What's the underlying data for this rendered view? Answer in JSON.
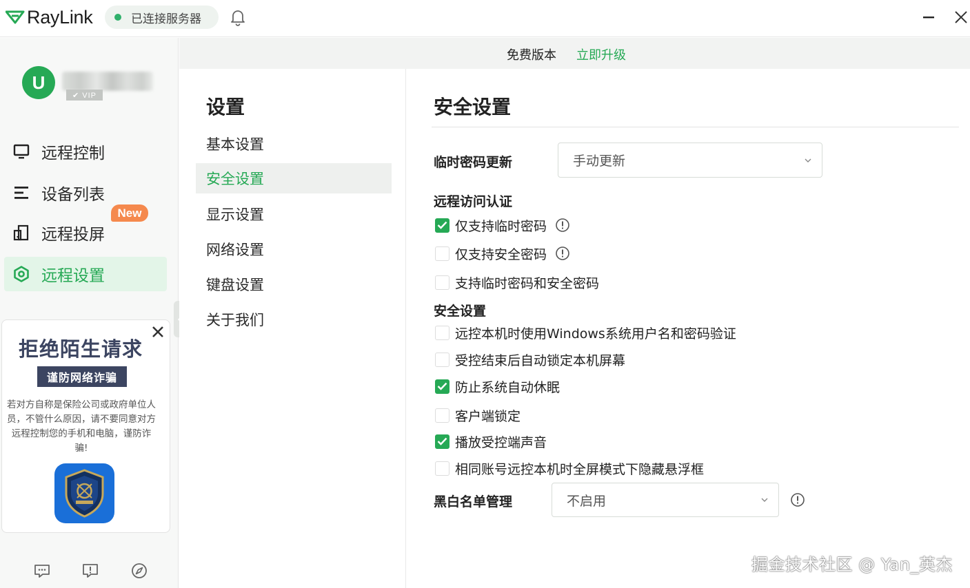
{
  "app": {
    "name": "RayLink",
    "connection_status": "已连接服务器",
    "colors": {
      "accent": "#26a955",
      "badge": "#f5894d",
      "promo_dark": "#3c4561"
    }
  },
  "user": {
    "avatar_letter": "U",
    "vip_label": "✔ VIP"
  },
  "sidebar": {
    "items": [
      {
        "label": "远程控制",
        "icon": "monitor-icon"
      },
      {
        "label": "设备列表",
        "icon": "list-icon"
      },
      {
        "label": "远程投屏",
        "icon": "screen-cast-icon",
        "badge": "New"
      },
      {
        "label": "远程设置",
        "icon": "settings-hex-icon",
        "active": true
      }
    ],
    "footer_icons": [
      "chat-icon",
      "feedback-icon",
      "compass-icon"
    ]
  },
  "promo": {
    "title": "拒绝陌生请求",
    "subtitle": "谨防网络诈骗",
    "body": "若对方自称是保险公司或政府单位人员，不管什么原因，请不要同意对方远程控制您的手机和电脑，谨防诈骗!"
  },
  "banner": {
    "edition": "免费版本",
    "upgrade": "立即升级"
  },
  "settings_menu": {
    "title": "设置",
    "items": [
      {
        "label": "基本设置"
      },
      {
        "label": "安全设置",
        "active": true
      },
      {
        "label": "显示设置"
      },
      {
        "label": "网络设置"
      },
      {
        "label": "键盘设置"
      },
      {
        "label": "关于我们"
      }
    ]
  },
  "content": {
    "title": "安全设置",
    "temp_password": {
      "label": "临时密码更新",
      "value": "手动更新"
    },
    "remote_auth": {
      "heading": "远程访问认证",
      "options": [
        {
          "label": "仅支持临时密码",
          "checked": true,
          "info": true
        },
        {
          "label": "仅支持安全密码",
          "checked": false,
          "info": true
        },
        {
          "label": "支持临时密码和安全密码",
          "checked": false,
          "info": false
        }
      ]
    },
    "security": {
      "heading": "安全设置",
      "options": [
        {
          "label": "远控本机时使用Windows系统用户名和密码验证",
          "checked": false
        },
        {
          "label": "受控结束后自动锁定本机屏幕",
          "checked": false
        },
        {
          "label": "防止系统自动休眠",
          "checked": true
        },
        {
          "label": "客户端锁定",
          "checked": false
        },
        {
          "label": "播放受控端声音",
          "checked": true
        },
        {
          "label": "相同账号远控本机时全屏模式下隐藏悬浮框",
          "checked": false
        }
      ]
    },
    "blacklist": {
      "label": "黑白名单管理",
      "value": "不启用"
    }
  },
  "watermark": "掘金技术社区 @ Yan_英杰"
}
